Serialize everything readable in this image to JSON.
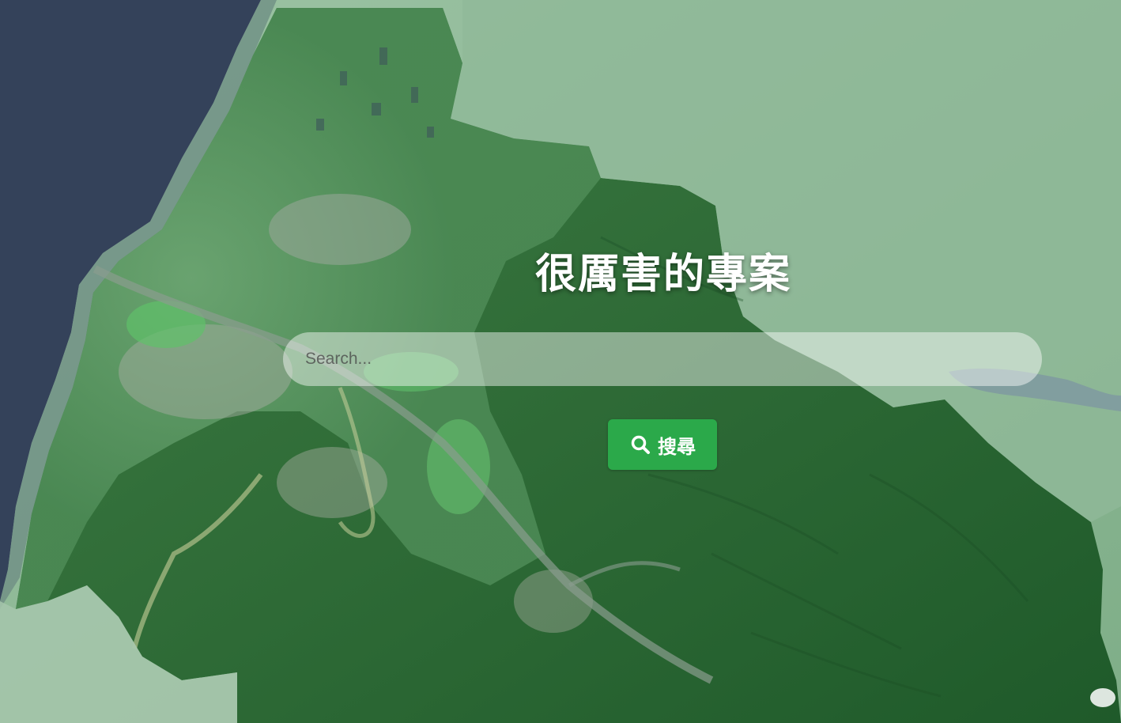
{
  "hero": {
    "title": "很厲害的專案"
  },
  "search": {
    "placeholder": "Search...",
    "value": "",
    "button_label": "搜尋",
    "button_icon": "search-icon"
  },
  "colors": {
    "button_bg": "#2ba94a",
    "title_text": "#ffffff",
    "sea": "#34425a"
  }
}
